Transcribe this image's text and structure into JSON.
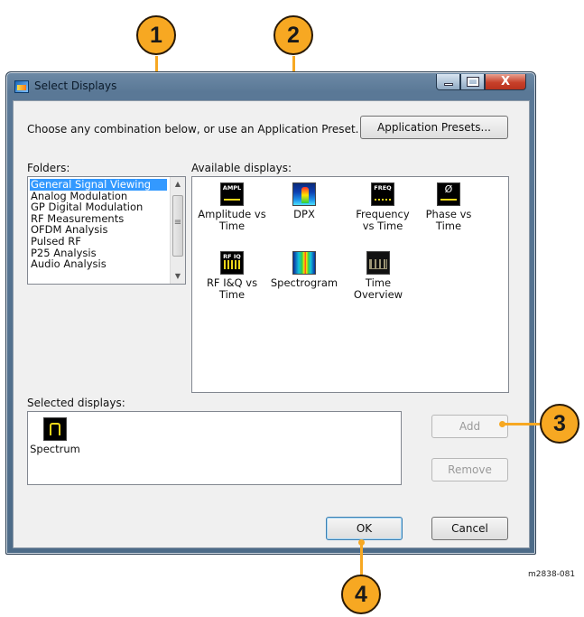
{
  "window": {
    "title": "Select Displays",
    "caption": {
      "minimize": "–",
      "maximize": "□",
      "close": "X"
    }
  },
  "header": {
    "instruction": "Choose any combination below, or use an Application Preset.",
    "presets_button": "Application Presets..."
  },
  "folders": {
    "label": "Folders:",
    "items": [
      "General Signal Viewing",
      "Analog Modulation",
      "GP Digital Modulation",
      "RF Measurements",
      "OFDM Analysis",
      "Pulsed RF",
      "P25 Analysis",
      "Audio Analysis"
    ],
    "selected_index": 0
  },
  "available": {
    "label": "Available displays:",
    "items": [
      {
        "icon": "amplitude-vs-time-icon",
        "icon_text": "AMPL",
        "label_line1": "Amplitude vs",
        "label_line2": "Time"
      },
      {
        "icon": "dpx-icon",
        "icon_text": "",
        "label_line1": "DPX",
        "label_line2": ""
      },
      {
        "icon": "frequency-vs-time-icon",
        "icon_text": "FREQ",
        "label_line1": "Frequency",
        "label_line2": "vs Time"
      },
      {
        "icon": "phase-vs-time-icon",
        "icon_text": "Ø",
        "label_line1": "Phase vs",
        "label_line2": "Time"
      },
      {
        "icon": "rf-iq-vs-time-icon",
        "icon_text": "RF IQ",
        "label_line1": "RF I&Q vs",
        "label_line2": "Time"
      },
      {
        "icon": "spectrogram-icon",
        "icon_text": "",
        "label_line1": "Spectrogram",
        "label_line2": ""
      },
      {
        "icon": "time-overview-icon",
        "icon_text": "",
        "label_line1": "Time",
        "label_line2": "Overview"
      }
    ]
  },
  "selected": {
    "label": "Selected displays:",
    "items": [
      {
        "icon": "spectrum-icon",
        "label": "Spectrum"
      }
    ]
  },
  "buttons": {
    "add": "Add",
    "remove": "Remove",
    "ok": "OK",
    "cancel": "Cancel"
  },
  "callouts": {
    "c1": "1",
    "c2": "2",
    "c3": "3",
    "c4": "4"
  },
  "figure_id": "m2838-081",
  "colors": {
    "callout": "#f7a822",
    "selection": "#3399ff"
  }
}
